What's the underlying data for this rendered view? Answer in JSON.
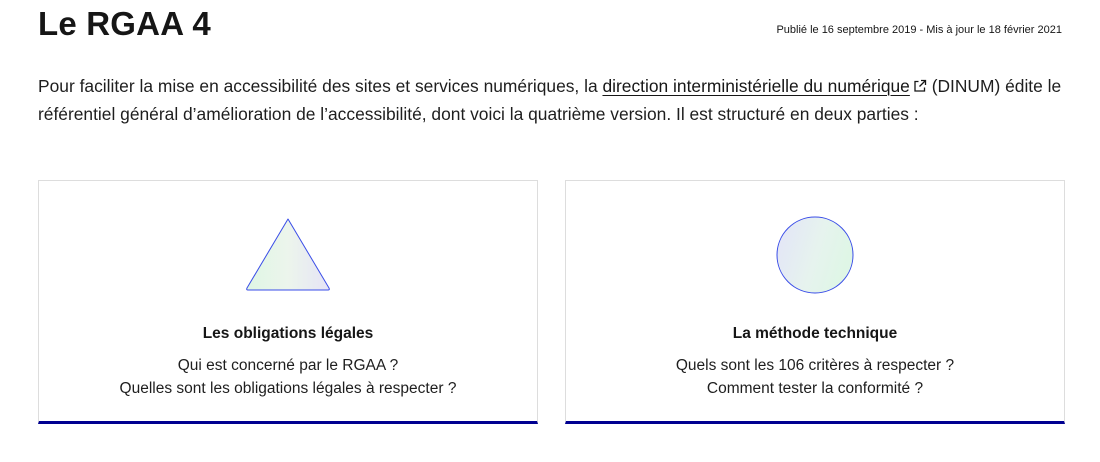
{
  "page": {
    "title": "Le RGAA 4",
    "meta": "Publié le 16 septembre 2019 - Mis à jour le 18 février 2021"
  },
  "intro": {
    "text_before": "Pour faciliter la mise en accessibilité des sites et services numériques, la ",
    "link_text": "direction interministérielle du numérique",
    "link_icon": "external-link-icon",
    "text_after": " (DINUM) édite le référentiel général d’amélioration de l’accessibilité, dont voici la quatrième version. Il est structuré en deux parties :"
  },
  "cards": [
    {
      "pictogram": "triangle-icon",
      "title": "Les obligations légales",
      "lines": [
        "Qui est concerné par le RGAA ?",
        "Quelles sont les obligations légales à respecter ?"
      ]
    },
    {
      "pictogram": "circle-icon",
      "title": "La méthode technique",
      "lines": [
        "Quels sont les 106 critères à respecter ?",
        "Comment tester la conformité ?"
      ]
    }
  ],
  "colors": {
    "accent": "#000091",
    "pictogram_stroke": "#3a4de8",
    "card_border": "#dddddd"
  }
}
